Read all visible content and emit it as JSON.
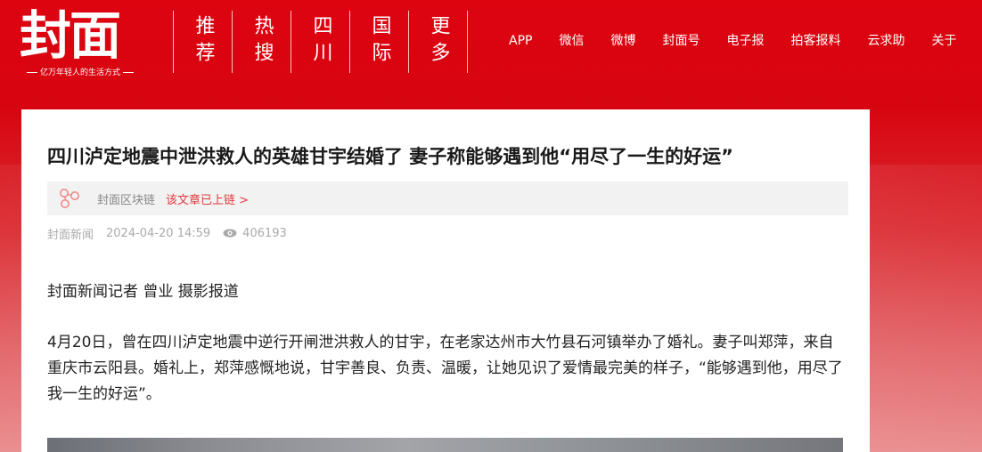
{
  "brand": {
    "logo_text": "封面",
    "tagline": "亿万年轻人的生活方式"
  },
  "channels": [
    "推荐",
    "热搜",
    "四川",
    "国际",
    "更多"
  ],
  "topnav": [
    "APP",
    "微信",
    "微博",
    "封面号",
    "电子报",
    "拍客报料",
    "云求助",
    "关于"
  ],
  "article": {
    "title": "四川泸定地震中泄洪救人的英雄甘宇结婚了 妻子称能够遇到他“用尽了一生的好运”",
    "blockchain_label": "封面区块链",
    "blockchain_link": "该文章已上链 >",
    "source": "封面新闻",
    "time": "2024-04-20 14:59",
    "views": "406193",
    "byline": "封面新闻记者 曾业 摄影报道",
    "paragraph": "4月20日，曾在四川泸定地震中逆行开闸泄洪救人的甘宇，在老家达州市大竹县石河镇举办了婚礼。妻子叫郑萍，来自重庆市云阳县。婚礼上，郑萍感慨地说，甘宇善良、负责、温暖，让她见识了爱情最完美的样子，“能够遇到他，用尽了我一生的好运”。"
  },
  "colors": {
    "brand_red": "#d9060f",
    "link_red": "#e4393c",
    "meta_gray": "#aaaaaa"
  },
  "icons": {
    "chain": "blockchain-icon",
    "views": "eye-icon"
  }
}
